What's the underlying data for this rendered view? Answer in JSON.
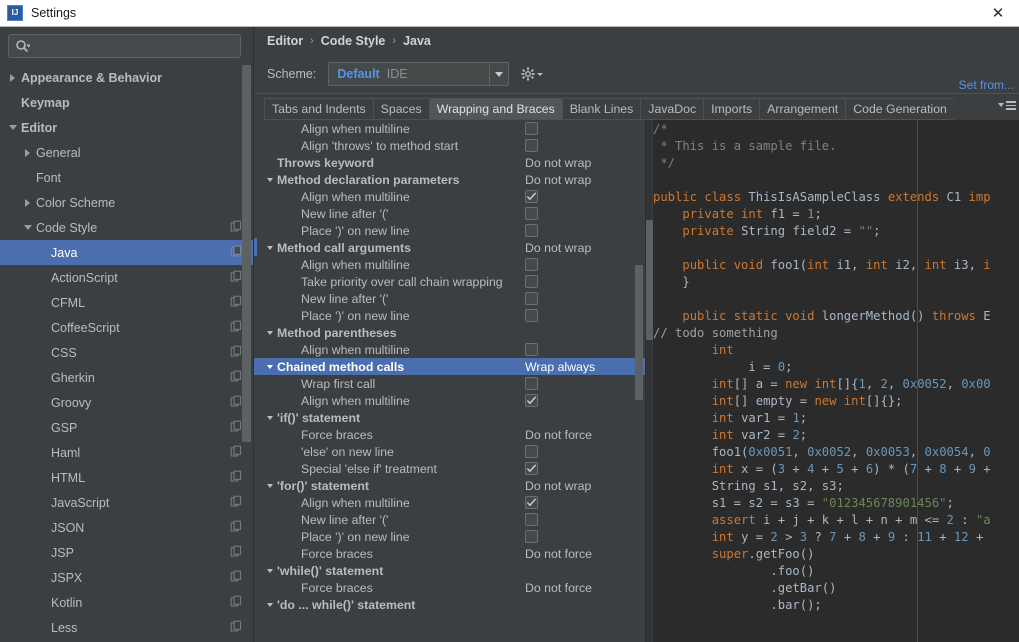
{
  "window": {
    "title": "Settings",
    "app_icon": "IJ",
    "close_icon": "close-icon"
  },
  "sidebar": {
    "search": {
      "placeholder": "",
      "value": "",
      "icon": "search-icon"
    },
    "items": [
      {
        "label": "Appearance & Behavior",
        "arrow": "right",
        "indent": 0,
        "bold": true,
        "copy": false,
        "selected": false
      },
      {
        "label": "Keymap",
        "arrow": "none",
        "indent": 0,
        "bold": true,
        "copy": false,
        "selected": false
      },
      {
        "label": "Editor",
        "arrow": "down",
        "indent": 0,
        "bold": true,
        "copy": false,
        "selected": false
      },
      {
        "label": "General",
        "arrow": "right",
        "indent": 1,
        "bold": false,
        "copy": false,
        "selected": false
      },
      {
        "label": "Font",
        "arrow": "none",
        "indent": 1,
        "bold": false,
        "copy": false,
        "selected": false
      },
      {
        "label": "Color Scheme",
        "arrow": "right",
        "indent": 1,
        "bold": false,
        "copy": false,
        "selected": false
      },
      {
        "label": "Code Style",
        "arrow": "down",
        "indent": 1,
        "bold": false,
        "copy": true,
        "selected": false
      },
      {
        "label": "Java",
        "arrow": "none",
        "indent": 2,
        "bold": false,
        "copy": true,
        "selected": true
      },
      {
        "label": "ActionScript",
        "arrow": "none",
        "indent": 2,
        "bold": false,
        "copy": true,
        "selected": false
      },
      {
        "label": "CFML",
        "arrow": "none",
        "indent": 2,
        "bold": false,
        "copy": true,
        "selected": false
      },
      {
        "label": "CoffeeScript",
        "arrow": "none",
        "indent": 2,
        "bold": false,
        "copy": true,
        "selected": false
      },
      {
        "label": "CSS",
        "arrow": "none",
        "indent": 2,
        "bold": false,
        "copy": true,
        "selected": false
      },
      {
        "label": "Gherkin",
        "arrow": "none",
        "indent": 2,
        "bold": false,
        "copy": true,
        "selected": false
      },
      {
        "label": "Groovy",
        "arrow": "none",
        "indent": 2,
        "bold": false,
        "copy": true,
        "selected": false
      },
      {
        "label": "GSP",
        "arrow": "none",
        "indent": 2,
        "bold": false,
        "copy": true,
        "selected": false
      },
      {
        "label": "Haml",
        "arrow": "none",
        "indent": 2,
        "bold": false,
        "copy": true,
        "selected": false
      },
      {
        "label": "HTML",
        "arrow": "none",
        "indent": 2,
        "bold": false,
        "copy": true,
        "selected": false
      },
      {
        "label": "JavaScript",
        "arrow": "none",
        "indent": 2,
        "bold": false,
        "copy": true,
        "selected": false
      },
      {
        "label": "JSON",
        "arrow": "none",
        "indent": 2,
        "bold": false,
        "copy": true,
        "selected": false
      },
      {
        "label": "JSP",
        "arrow": "none",
        "indent": 2,
        "bold": false,
        "copy": true,
        "selected": false
      },
      {
        "label": "JSPX",
        "arrow": "none",
        "indent": 2,
        "bold": false,
        "copy": true,
        "selected": false
      },
      {
        "label": "Kotlin",
        "arrow": "none",
        "indent": 2,
        "bold": false,
        "copy": true,
        "selected": false
      },
      {
        "label": "Less",
        "arrow": "none",
        "indent": 2,
        "bold": false,
        "copy": true,
        "selected": false
      }
    ]
  },
  "breadcrumb": {
    "parts": [
      "Editor",
      "Code Style",
      "Java"
    ],
    "separator": "›"
  },
  "scheme": {
    "label": "Scheme:",
    "value": "Default",
    "scope": "IDE",
    "gear_icon": "gear-icon",
    "dropdown_icon": "chevron-down-icon"
  },
  "set_from_link": "Set from...",
  "tabs": {
    "items": [
      {
        "label": "Tabs and Indents",
        "active": false
      },
      {
        "label": "Spaces",
        "active": false
      },
      {
        "label": "Wrapping and Braces",
        "active": true
      },
      {
        "label": "Blank Lines",
        "active": false
      },
      {
        "label": "JavaDoc",
        "active": false
      },
      {
        "label": "Imports",
        "active": false
      },
      {
        "label": "Arrangement",
        "active": false
      },
      {
        "label": "Code Generation",
        "active": false
      }
    ],
    "overflow_icon": "tab-overflow-icon"
  },
  "options": [
    {
      "label": "Align when multiline",
      "type": "checkbox",
      "checked": false,
      "group": false,
      "toggle": "none",
      "selected": false
    },
    {
      "label": "Align 'throws' to method start",
      "type": "checkbox",
      "checked": false,
      "group": false,
      "toggle": "none",
      "selected": false
    },
    {
      "label": "Throws keyword",
      "type": "value",
      "value": "Do not wrap",
      "group": true,
      "toggle": "none",
      "selected": false
    },
    {
      "label": "Method declaration parameters",
      "type": "value",
      "value": "Do not wrap",
      "group": true,
      "toggle": "down",
      "selected": false
    },
    {
      "label": "Align when multiline",
      "type": "checkbox",
      "checked": true,
      "group": false,
      "toggle": "none",
      "selected": false
    },
    {
      "label": "New line after '('",
      "type": "checkbox",
      "checked": false,
      "group": false,
      "toggle": "none",
      "selected": false
    },
    {
      "label": "Place ')' on new line",
      "type": "checkbox",
      "checked": false,
      "group": false,
      "toggle": "none",
      "selected": false
    },
    {
      "label": "Method call arguments",
      "type": "value",
      "value": "Do not wrap",
      "group": true,
      "toggle": "down",
      "selected": false
    },
    {
      "label": "Align when multiline",
      "type": "checkbox",
      "checked": false,
      "group": false,
      "toggle": "none",
      "selected": false
    },
    {
      "label": "Take priority over call chain wrapping",
      "type": "checkbox",
      "checked": false,
      "group": false,
      "toggle": "none",
      "selected": false
    },
    {
      "label": "New line after '('",
      "type": "checkbox",
      "checked": false,
      "group": false,
      "toggle": "none",
      "selected": false
    },
    {
      "label": "Place ')' on new line",
      "type": "checkbox",
      "checked": false,
      "group": false,
      "toggle": "none",
      "selected": false
    },
    {
      "label": "Method parentheses",
      "type": "none",
      "value": "",
      "group": true,
      "toggle": "down",
      "selected": false
    },
    {
      "label": "Align when multiline",
      "type": "checkbox",
      "checked": false,
      "group": false,
      "toggle": "none",
      "selected": false
    },
    {
      "label": "Chained method calls",
      "type": "value",
      "value": "Wrap always",
      "group": true,
      "toggle": "down",
      "selected": true
    },
    {
      "label": "Wrap first call",
      "type": "checkbox",
      "checked": false,
      "group": false,
      "toggle": "none",
      "selected": false
    },
    {
      "label": "Align when multiline",
      "type": "checkbox",
      "checked": true,
      "group": false,
      "toggle": "none",
      "selected": false
    },
    {
      "label": "'if()' statement",
      "type": "none",
      "value": "",
      "group": true,
      "toggle": "down",
      "selected": false
    },
    {
      "label": "Force braces",
      "type": "value",
      "value": "Do not force",
      "group": false,
      "toggle": "none",
      "selected": false
    },
    {
      "label": "'else' on new line",
      "type": "checkbox",
      "checked": false,
      "group": false,
      "toggle": "none",
      "selected": false
    },
    {
      "label": "Special 'else if' treatment",
      "type": "checkbox",
      "checked": true,
      "group": false,
      "toggle": "none",
      "selected": false
    },
    {
      "label": "'for()' statement",
      "type": "value",
      "value": "Do not wrap",
      "group": true,
      "toggle": "down",
      "selected": false
    },
    {
      "label": "Align when multiline",
      "type": "checkbox",
      "checked": true,
      "group": false,
      "toggle": "none",
      "selected": false
    },
    {
      "label": "New line after '('",
      "type": "checkbox",
      "checked": false,
      "group": false,
      "toggle": "none",
      "selected": false
    },
    {
      "label": "Place ')' on new line",
      "type": "checkbox",
      "checked": false,
      "group": false,
      "toggle": "none",
      "selected": false
    },
    {
      "label": "Force braces",
      "type": "value",
      "value": "Do not force",
      "group": false,
      "toggle": "none",
      "selected": false
    },
    {
      "label": "'while()' statement",
      "type": "none",
      "value": "",
      "group": true,
      "toggle": "down",
      "selected": false
    },
    {
      "label": "Force braces",
      "type": "value",
      "value": "Do not force",
      "group": false,
      "toggle": "none",
      "selected": false
    },
    {
      "label": "'do ... while()' statement",
      "type": "none",
      "value": "",
      "group": true,
      "toggle": "down",
      "selected": false
    }
  ],
  "preview": {
    "lines": [
      [
        {
          "t": "/*",
          "c": "cmt"
        }
      ],
      [
        {
          "t": " * This is a sample file.",
          "c": "cmt"
        }
      ],
      [
        {
          "t": " */",
          "c": "cmt"
        }
      ],
      [
        {
          "t": "",
          "c": "pln"
        }
      ],
      [
        {
          "t": "public class ",
          "c": "kw"
        },
        {
          "t": "ThisIsASampleClass ",
          "c": "cls"
        },
        {
          "t": "extends ",
          "c": "kw"
        },
        {
          "t": "C1 ",
          "c": "cls"
        },
        {
          "t": "imp",
          "c": "kw"
        }
      ],
      [
        {
          "t": "    ",
          "c": "pln"
        },
        {
          "t": "private int ",
          "c": "kw"
        },
        {
          "t": "f1 = ",
          "c": "pln"
        },
        {
          "t": "1",
          "c": "num"
        },
        {
          "t": ";",
          "c": "pln"
        }
      ],
      [
        {
          "t": "    ",
          "c": "pln"
        },
        {
          "t": "private ",
          "c": "kw"
        },
        {
          "t": "String ",
          "c": "cls"
        },
        {
          "t": "field2 = ",
          "c": "pln"
        },
        {
          "t": "\"\"",
          "c": "str"
        },
        {
          "t": ";",
          "c": "pln"
        }
      ],
      [
        {
          "t": "",
          "c": "pln"
        }
      ],
      [
        {
          "t": "    ",
          "c": "pln"
        },
        {
          "t": "public void ",
          "c": "kw"
        },
        {
          "t": "foo1(",
          "c": "cls"
        },
        {
          "t": "int ",
          "c": "kw"
        },
        {
          "t": "i1, ",
          "c": "pln"
        },
        {
          "t": "int ",
          "c": "kw"
        },
        {
          "t": "i2, ",
          "c": "pln"
        },
        {
          "t": "int ",
          "c": "kw"
        },
        {
          "t": "i3, ",
          "c": "pln"
        },
        {
          "t": "i",
          "c": "kw"
        }
      ],
      [
        {
          "t": "    }",
          "c": "pln"
        }
      ],
      [
        {
          "t": "",
          "c": "pln"
        }
      ],
      [
        {
          "t": "    ",
          "c": "pln"
        },
        {
          "t": "public static void ",
          "c": "kw"
        },
        {
          "t": "longerMethod() ",
          "c": "cls"
        },
        {
          "t": "throws ",
          "c": "kw"
        },
        {
          "t": "E",
          "c": "cls"
        }
      ],
      [
        {
          "t": "// todo something",
          "c": "todo"
        }
      ],
      [
        {
          "t": "        ",
          "c": "pln"
        },
        {
          "t": "int",
          "c": "kw"
        }
      ],
      [
        {
          "t": "             i = ",
          "c": "pln"
        },
        {
          "t": "0",
          "c": "num"
        },
        {
          "t": ";",
          "c": "pln"
        }
      ],
      [
        {
          "t": "        ",
          "c": "pln"
        },
        {
          "t": "int",
          "c": "kw"
        },
        {
          "t": "[] a = ",
          "c": "pln"
        },
        {
          "t": "new int",
          "c": "kw"
        },
        {
          "t": "[]{",
          "c": "pln"
        },
        {
          "t": "1",
          "c": "num"
        },
        {
          "t": ", ",
          "c": "pln"
        },
        {
          "t": "2",
          "c": "num"
        },
        {
          "t": ", ",
          "c": "pln"
        },
        {
          "t": "0x0052",
          "c": "num"
        },
        {
          "t": ", ",
          "c": "pln"
        },
        {
          "t": "0x00",
          "c": "num"
        }
      ],
      [
        {
          "t": "        ",
          "c": "pln"
        },
        {
          "t": "int",
          "c": "kw"
        },
        {
          "t": "[] empty = ",
          "c": "pln"
        },
        {
          "t": "new int",
          "c": "kw"
        },
        {
          "t": "[]{};",
          "c": "pln"
        }
      ],
      [
        {
          "t": "        ",
          "c": "pln"
        },
        {
          "t": "int ",
          "c": "kw"
        },
        {
          "t": "var1 = ",
          "c": "pln"
        },
        {
          "t": "1",
          "c": "num"
        },
        {
          "t": ";",
          "c": "pln"
        }
      ],
      [
        {
          "t": "        ",
          "c": "pln"
        },
        {
          "t": "int ",
          "c": "kw"
        },
        {
          "t": "var2 = ",
          "c": "pln"
        },
        {
          "t": "2",
          "c": "num"
        },
        {
          "t": ";",
          "c": "pln"
        }
      ],
      [
        {
          "t": "        foo1(",
          "c": "pln"
        },
        {
          "t": "0x0051",
          "c": "num"
        },
        {
          "t": ", ",
          "c": "pln"
        },
        {
          "t": "0x0052",
          "c": "num"
        },
        {
          "t": ", ",
          "c": "pln"
        },
        {
          "t": "0x0053",
          "c": "num"
        },
        {
          "t": ", ",
          "c": "pln"
        },
        {
          "t": "0x0054",
          "c": "num"
        },
        {
          "t": ", ",
          "c": "pln"
        },
        {
          "t": "0",
          "c": "num"
        }
      ],
      [
        {
          "t": "        ",
          "c": "pln"
        },
        {
          "t": "int ",
          "c": "kw"
        },
        {
          "t": "x = (",
          "c": "pln"
        },
        {
          "t": "3",
          "c": "num"
        },
        {
          "t": " + ",
          "c": "pln"
        },
        {
          "t": "4",
          "c": "num"
        },
        {
          "t": " + ",
          "c": "pln"
        },
        {
          "t": "5",
          "c": "num"
        },
        {
          "t": " + ",
          "c": "pln"
        },
        {
          "t": "6",
          "c": "num"
        },
        {
          "t": ") * (",
          "c": "pln"
        },
        {
          "t": "7",
          "c": "num"
        },
        {
          "t": " + ",
          "c": "pln"
        },
        {
          "t": "8",
          "c": "num"
        },
        {
          "t": " + ",
          "c": "pln"
        },
        {
          "t": "9",
          "c": "num"
        },
        {
          "t": " +",
          "c": "pln"
        }
      ],
      [
        {
          "t": "        ",
          "c": "pln"
        },
        {
          "t": "String ",
          "c": "cls"
        },
        {
          "t": "s1, s2, s3;",
          "c": "pln"
        }
      ],
      [
        {
          "t": "        s1 = s2 = s3 = ",
          "c": "pln"
        },
        {
          "t": "\"012345678901456\"",
          "c": "str"
        },
        {
          "t": ";",
          "c": "pln"
        }
      ],
      [
        {
          "t": "        ",
          "c": "pln"
        },
        {
          "t": "assert ",
          "c": "kw"
        },
        {
          "t": "i + j + k + l + n + m <= ",
          "c": "pln"
        },
        {
          "t": "2",
          "c": "num"
        },
        {
          "t": " : ",
          "c": "pln"
        },
        {
          "t": "\"a",
          "c": "str"
        }
      ],
      [
        {
          "t": "        ",
          "c": "pln"
        },
        {
          "t": "int ",
          "c": "kw"
        },
        {
          "t": "y = ",
          "c": "pln"
        },
        {
          "t": "2",
          "c": "num"
        },
        {
          "t": " > ",
          "c": "pln"
        },
        {
          "t": "3",
          "c": "num"
        },
        {
          "t": " ? ",
          "c": "pln"
        },
        {
          "t": "7",
          "c": "num"
        },
        {
          "t": " + ",
          "c": "pln"
        },
        {
          "t": "8",
          "c": "num"
        },
        {
          "t": " + ",
          "c": "pln"
        },
        {
          "t": "9",
          "c": "num"
        },
        {
          "t": " : ",
          "c": "pln"
        },
        {
          "t": "11",
          "c": "num"
        },
        {
          "t": " + ",
          "c": "pln"
        },
        {
          "t": "12",
          "c": "num"
        },
        {
          "t": " + ",
          "c": "pln"
        }
      ],
      [
        {
          "t": "        ",
          "c": "pln"
        },
        {
          "t": "super",
          "c": "kw"
        },
        {
          "t": ".getFoo()",
          "c": "pln"
        }
      ],
      [
        {
          "t": "                .foo()",
          "c": "pln"
        }
      ],
      [
        {
          "t": "                .getBar()",
          "c": "pln"
        }
      ],
      [
        {
          "t": "                .bar();",
          "c": "pln"
        }
      ]
    ]
  }
}
